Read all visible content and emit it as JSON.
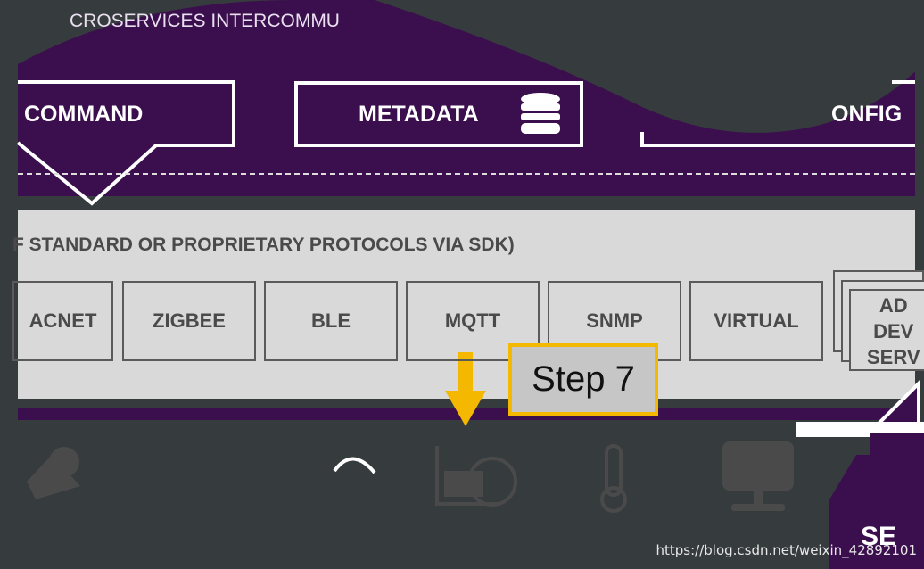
{
  "header_text": "CROSERVICES INTERCOMMU",
  "services": {
    "command": "COMMAND",
    "metadata": "METADATA",
    "config": "ONFIG"
  },
  "device_layer_caption": "F STANDARD OR PROPRIETARY PROTOCOLS VIA SDK)",
  "protocols": [
    "ACNET",
    "ZIGBEE",
    "BLE",
    "MQTT",
    "SNMP",
    "VIRTUAL"
  ],
  "additional_service": [
    "AD",
    "DEV",
    "SERV"
  ],
  "step_label": "Step 7",
  "bottom_partial": "SE",
  "watermark": "https://blog.csdn.net/weixin_42892101",
  "icons": [
    "sensor-cluster-icon",
    "gauge-icon",
    "lab-device-icon",
    "thermometer-icon",
    "monitor-network-icon",
    "database-icon"
  ],
  "colors": {
    "background": "#363b3e",
    "purple": "#3b0f4e",
    "band": "#d9d9d9",
    "highlight": "#f5b800"
  }
}
